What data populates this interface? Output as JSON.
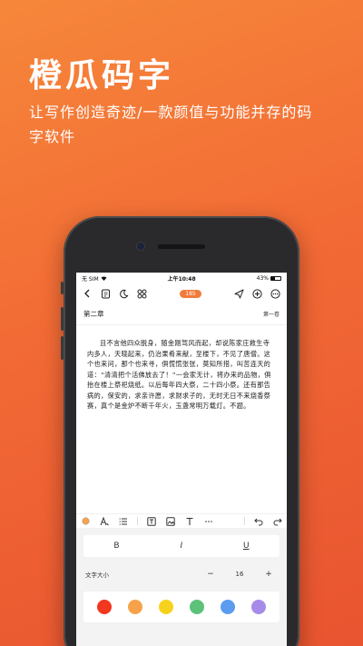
{
  "promo": {
    "title": "橙瓜码字",
    "subtitle": "让写作创造奇迹/一款颜值与功能并存的码字软件"
  },
  "status_bar": {
    "carrier": "无 SIM",
    "time": "上午10:48",
    "battery": "43%"
  },
  "toolbar": {
    "word_count": "185"
  },
  "chapter": {
    "title": "第二章",
    "volume": "第一卷"
  },
  "body": {
    "text": "且不言他四众脱身，随金刚驾风而起，却说陈家庄救生寺内多人，天晓起来，仍治果肴来献，至楼下，不见了唐僧。这个也来问，那个也来寻，俱慌慌张张，莫知所措，叫苦连天的道：“清清把个活佛放去了！”一会家无计，将办来的品物，俱抬在楼上祭祀烧纸。以后每年四大祭，二十四小祭。还有那告病的，保安的，求亲许愿，求财求子的，无时无日不来烧香祭赛，真个是金炉不断千年火，玉盏常明万载灯。不题。"
  },
  "format_panel": {
    "bold": "B",
    "italic": "I",
    "underline": "U",
    "font_size_label": "文字大小",
    "minus": "−",
    "font_size_value": "16",
    "plus": "+",
    "colors": [
      "#f2371f",
      "#f6a24a",
      "#f7d21c",
      "#5cc27a",
      "#5b9cf0",
      "#a78be8"
    ]
  }
}
